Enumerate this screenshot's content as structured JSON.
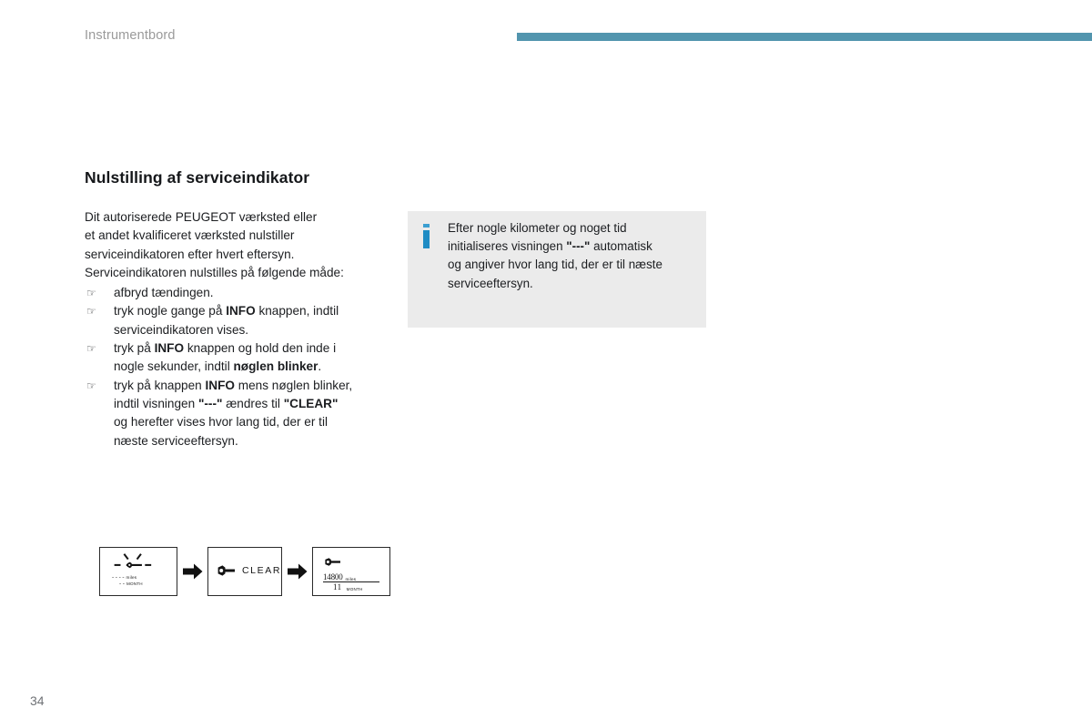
{
  "header": {
    "running_head": "Instrumentbord",
    "rule_color": "#5295ae"
  },
  "section": {
    "title": "Nulstilling af serviceindikator"
  },
  "body": {
    "intro_lines": [
      "Dit autoriserede PEUGEOT værksted eller",
      "et andet kvalificeret værksted nulstiller",
      "serviceindikatoren efter hvert eftersyn.",
      "Serviceindikatoren nulstilles på følgende måde:"
    ],
    "bullet_marker": "☞",
    "bullets": [
      {
        "lines": [
          [
            {
              "t": "afbryd tændingen.",
              "b": false
            }
          ]
        ]
      },
      {
        "lines": [
          [
            {
              "t": "tryk nogle gange på ",
              "b": false
            },
            {
              "t": "INFO",
              "b": true
            },
            {
              "t": " knappen, indtil",
              "b": false
            }
          ],
          [
            {
              "t": "serviceindikatoren vises.",
              "b": false
            }
          ]
        ]
      },
      {
        "lines": [
          [
            {
              "t": "tryk på ",
              "b": false
            },
            {
              "t": "INFO",
              "b": true
            },
            {
              "t": " knappen og hold den inde i",
              "b": false
            }
          ],
          [
            {
              "t": "nogle sekunder, indtil ",
              "b": false
            },
            {
              "t": "nøglen blinker",
              "b": true
            },
            {
              "t": ".",
              "b": false
            }
          ]
        ]
      },
      {
        "lines": [
          [
            {
              "t": "tryk på knappen ",
              "b": false
            },
            {
              "t": "INFO",
              "b": true
            },
            {
              "t": " mens nøglen blinker,",
              "b": false
            }
          ],
          [
            {
              "t": "indtil visningen ",
              "b": false
            },
            {
              "t": "\"---\"",
              "b": true
            },
            {
              "t": " ændres til ",
              "b": false
            },
            {
              "t": "\"CLEAR\"",
              "b": true
            }
          ],
          [
            {
              "t": "og herefter vises hvor lang tid, der er til",
              "b": false
            }
          ],
          [
            {
              "t": "næste serviceeftersyn.",
              "b": false
            }
          ]
        ]
      }
    ]
  },
  "info_box": {
    "icon": "info-icon",
    "icon_color": "#1f8cc4",
    "background": "#ebebeb",
    "lines": [
      [
        {
          "t": "Efter nogle kilometer og noget tid",
          "b": false
        }
      ],
      [
        {
          "t": "initialiseres visningen ",
          "b": false
        },
        {
          "t": "\"---\"",
          "b": true
        },
        {
          "t": " automatisk",
          "b": false
        }
      ],
      [
        {
          "t": "og angiver hvor lang tid, der er til næste",
          "b": false
        }
      ],
      [
        {
          "t": "serviceeftersyn.",
          "b": false
        }
      ]
    ]
  },
  "diagram": {
    "arrow_glyph": "➡",
    "panels": [
      {
        "id": "panel-blinking-service",
        "icon": "blinking-wrench-icon",
        "distance_value": "- - - -",
        "distance_unit": "miles",
        "months_value": "- -",
        "months_unit": "MONTH"
      },
      {
        "id": "panel-clear",
        "icon": "wrench-icon",
        "label": "CLEAR"
      },
      {
        "id": "panel-result",
        "icon": "wrench-icon",
        "distance_value": "14800",
        "distance_unit": "miles",
        "months_value": "11",
        "months_unit": "MONTH"
      }
    ]
  },
  "footer": {
    "page_number": "34"
  }
}
